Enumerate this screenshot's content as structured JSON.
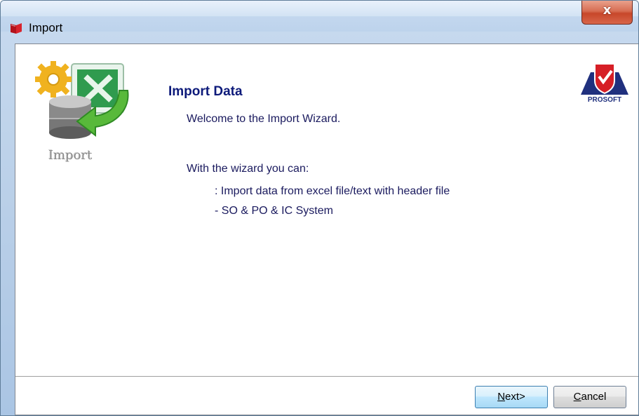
{
  "window": {
    "title": "Import",
    "app_icon": "book-icon",
    "close_symbol": "x"
  },
  "side_logo": {
    "icon": "import-wizard-icon",
    "label": "Import"
  },
  "brand_logo": {
    "icon": "prosoft-logo",
    "text": "PROSOFT"
  },
  "content": {
    "heading": "Import Data",
    "welcome": "Welcome to the Import Wizard.",
    "intro": "With the wizard you can:",
    "items": [
      ": Import data from excel file/text with header file",
      "- SO & PO & IC  System"
    ]
  },
  "buttons": {
    "next_label_prefix": "N",
    "next_label_rest": "ext>",
    "cancel_label_prefix": "C",
    "cancel_label_rest": "ancel"
  },
  "colors": {
    "heading": "#0d1a7a",
    "body_text": "#1a1a5e",
    "close_button": "#c7472a",
    "title_bar": "#c6d9ee"
  }
}
